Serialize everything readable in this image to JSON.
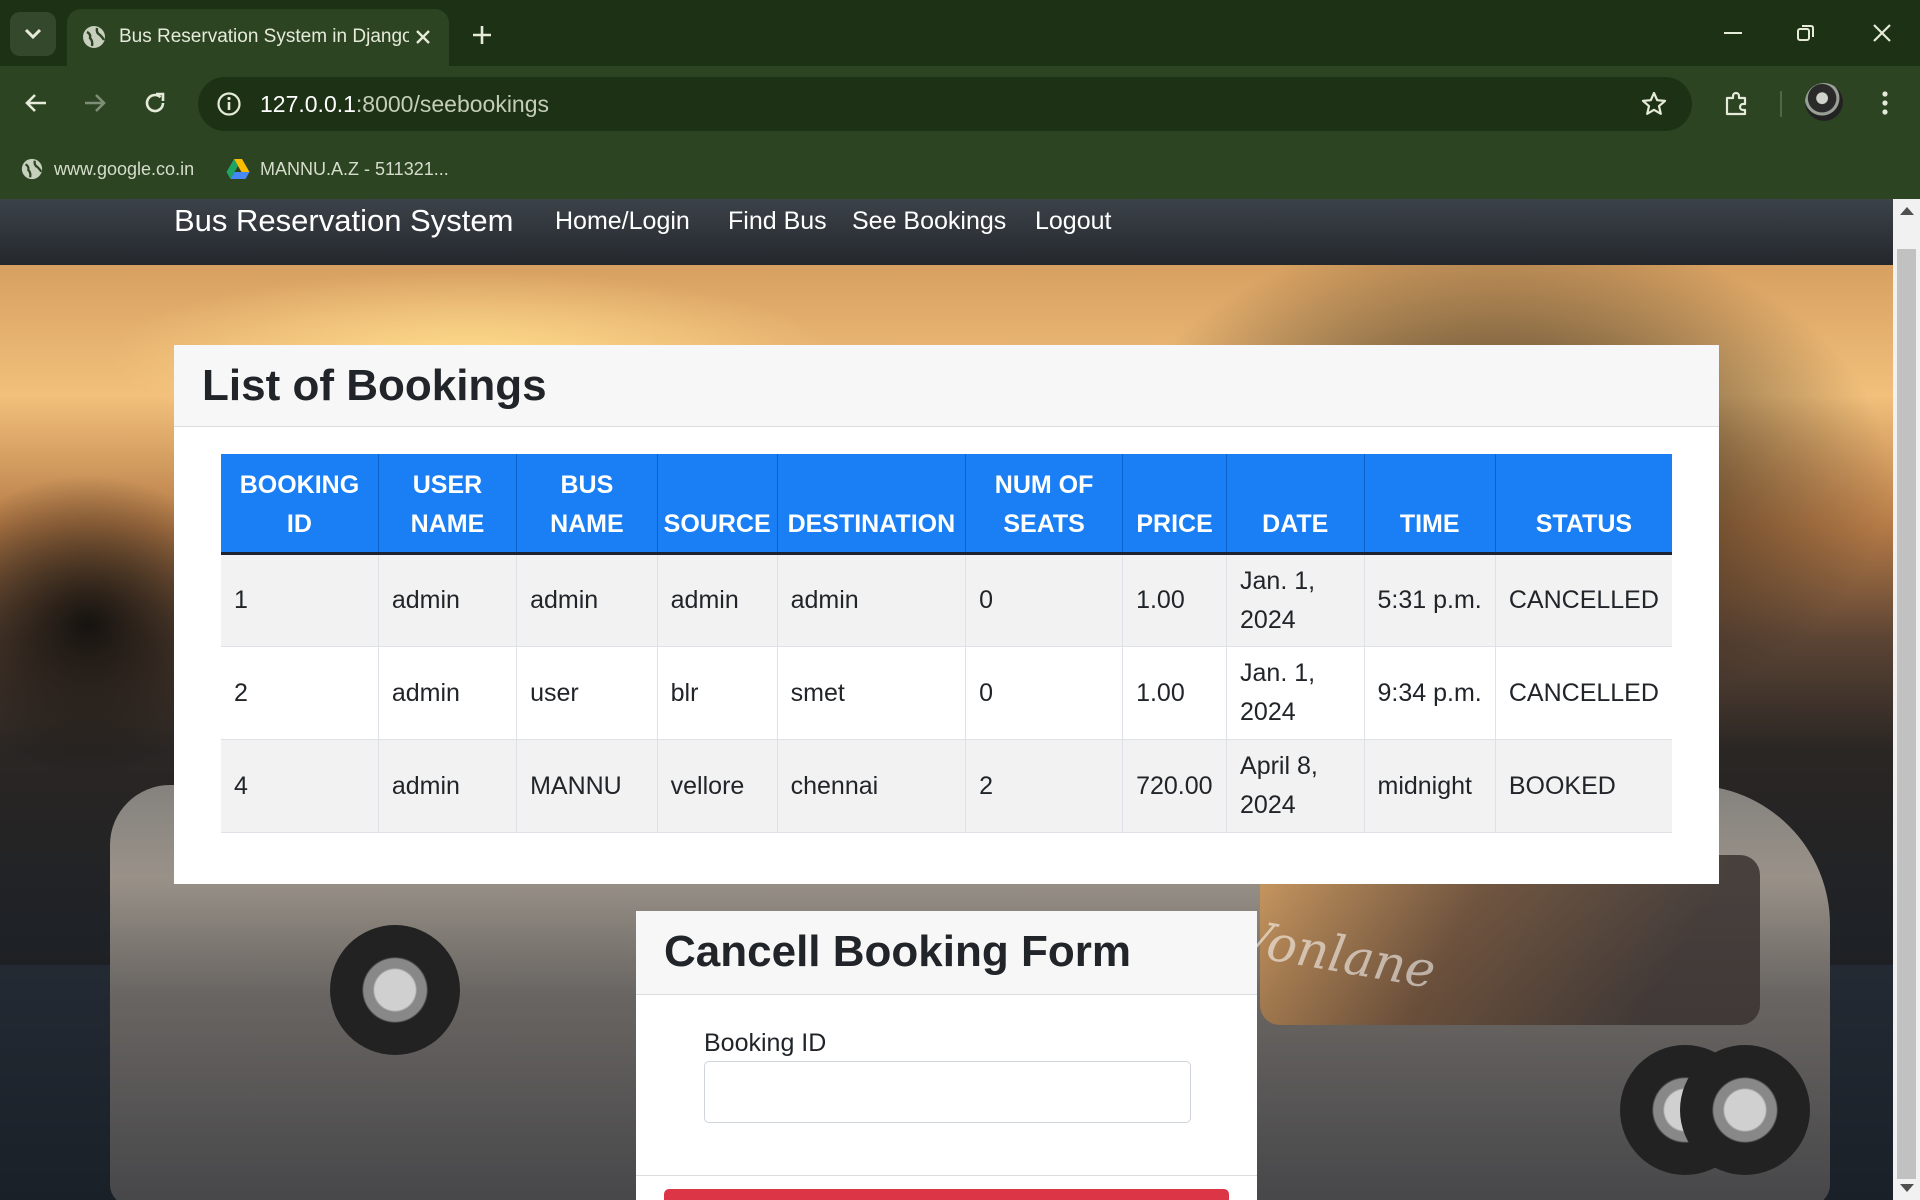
{
  "browser": {
    "tab_title": "Bus Reservation System in Django",
    "url_host": "127.0.0.1",
    "url_path": ":8000/seebookings",
    "bookmarks": [
      {
        "label": "www.google.co.in",
        "icon": "globe-icon"
      },
      {
        "label": "MANNU.A.Z - 511321...",
        "icon": "google-drive-icon"
      }
    ]
  },
  "navbar": {
    "brand": "Bus Reservation System",
    "links": [
      "Home/Login",
      "Find Bus",
      "See Bookings",
      "Logout"
    ]
  },
  "bookings": {
    "title": "List of Bookings",
    "columns": [
      [
        "BOOKING",
        "ID"
      ],
      [
        "USER",
        "NAME"
      ],
      [
        "BUS",
        "NAME"
      ],
      [
        "",
        "SOURCE"
      ],
      [
        "",
        "DESTINATION"
      ],
      [
        "NUM OF",
        "SEATS"
      ],
      [
        "",
        "PRICE"
      ],
      [
        "",
        "DATE"
      ],
      [
        "",
        "TIME"
      ],
      [
        "",
        "STATUS"
      ]
    ],
    "rows": [
      [
        "1",
        "admin",
        "admin",
        "admin",
        "admin",
        "0",
        "1.00",
        "Jan. 1, 2024",
        "5:31 p.m.",
        "CANCELLED"
      ],
      [
        "2",
        "admin",
        "user",
        "blr",
        "smet",
        "0",
        "1.00",
        "Jan. 1, 2024",
        "9:34 p.m.",
        "CANCELLED"
      ],
      [
        "4",
        "admin",
        "MANNU",
        "vellore",
        "chennai",
        "2",
        "720.00",
        "April 8, 2024",
        "midnight",
        "BOOKED"
      ]
    ]
  },
  "cancel_form": {
    "title": "Cancell Booking Form",
    "field_label": "Booking ID",
    "field_value": ""
  },
  "colors": {
    "table_header": "#1a7ff5",
    "submit_button": "#dc3545",
    "browser_frame": "#2d4423"
  }
}
